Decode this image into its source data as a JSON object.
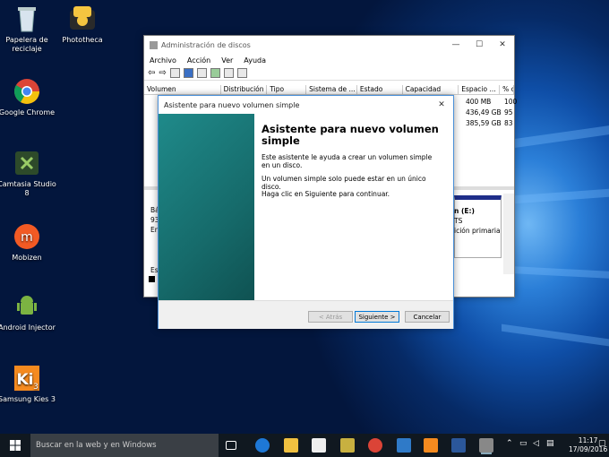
{
  "desktop": {
    "icons": [
      {
        "label": "Papelera de reciclaje",
        "name": "recycle-bin-icon"
      },
      {
        "label": "Phototheca",
        "name": "phototheca-icon"
      },
      {
        "label": "Google Chrome",
        "name": "chrome-icon"
      },
      {
        "label": "Camtasia Studio 8",
        "name": "camtasia-icon"
      },
      {
        "label": "Mobizen",
        "name": "mobizen-icon"
      },
      {
        "label": "Android Injector",
        "name": "android-injector-icon"
      },
      {
        "label": "Samsung Kies 3",
        "name": "samsung-kies-icon"
      }
    ]
  },
  "disk_mgmt": {
    "title": "Administración de discos",
    "menu": [
      "Archivo",
      "Acción",
      "Ver",
      "Ayuda"
    ],
    "columns": [
      "Volumen",
      "Distribución",
      "Tipo",
      "Sistema de ...",
      "Estado",
      "Capacidad",
      "Espacio ...",
      "% c"
    ],
    "rows": [
      {
        "space": "400 MB",
        "pct": "100"
      },
      {
        "space": "436,49 GB",
        "pct": "95"
      },
      {
        "space": "385,59 GB",
        "pct": "83"
      }
    ],
    "lower": {
      "left": [
        "Bá",
        "93",
        "En",
        "Est"
      ],
      "right": [
        "n (E:)",
        "TS",
        "ición primaria"
      ]
    }
  },
  "wizard": {
    "title": "Asistente para nuevo volumen simple",
    "heading": "Asistente para nuevo volumen simple",
    "p1": "Este asistente le ayuda a crear un volumen simple en un disco.",
    "p2": "Un volumen simple solo puede estar en un único disco.",
    "p3": "Haga clic en Siguiente para continuar.",
    "back": "< Atrás",
    "next": "Siguiente >",
    "cancel": "Cancelar"
  },
  "taskbar": {
    "search": "Buscar en la web y en Windows",
    "time": "11:17",
    "date": "17/09/2016"
  },
  "colors": {
    "accent": "#1a7a7a",
    "taskbar": "#101820"
  }
}
